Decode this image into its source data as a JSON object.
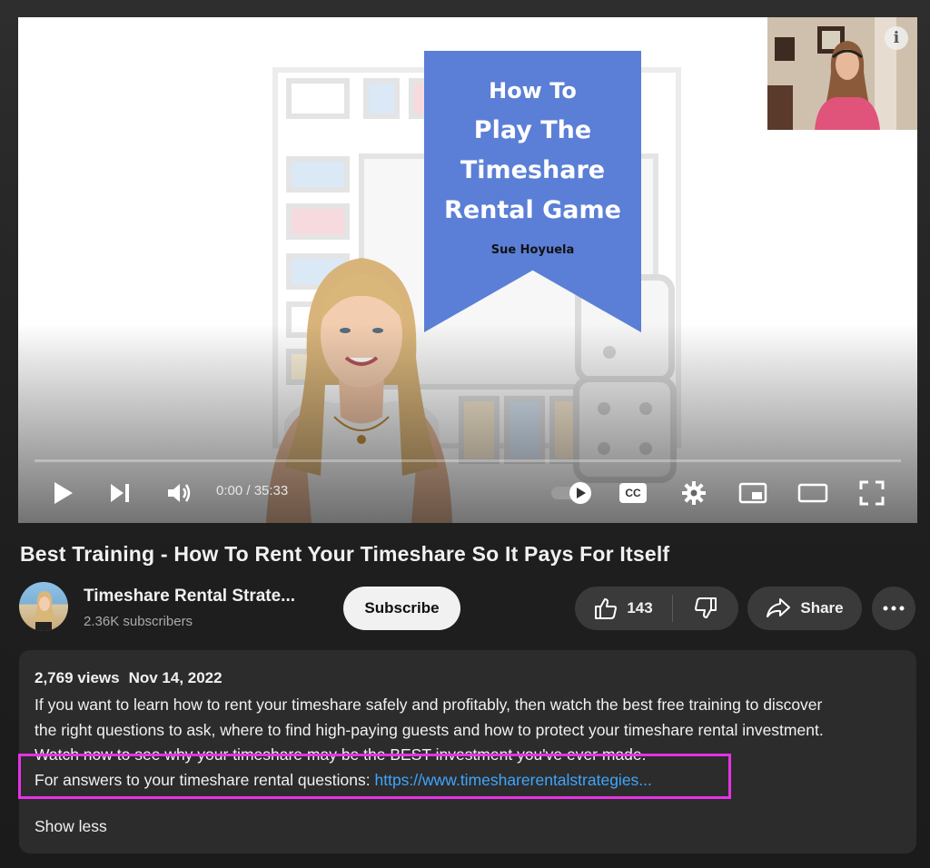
{
  "player": {
    "thumbnail": {
      "title_lines": [
        "How To",
        "Play The",
        "Timeshare",
        "Rental Game"
      ],
      "author": "Sue Hoyuela"
    },
    "time_display": "0:00 / 35:33",
    "progress_fraction": 0.0,
    "icons": [
      "play-icon",
      "next-icon",
      "volume-icon",
      "autoplay-toggle",
      "cc-icon",
      "gear-icon",
      "miniplayer-icon",
      "theater-icon",
      "fullscreen-icon",
      "info-icon"
    ],
    "cc_label": "CC",
    "info_label": "i"
  },
  "video": {
    "title": "Best Training - How To Rent Your Timeshare So It Pays For Itself"
  },
  "channel": {
    "name": "Timeshare Rental Strate...",
    "subscribers": "2.36K subscribers",
    "subscribe_label": "Subscribe"
  },
  "actions": {
    "like_count": "143",
    "share_label": "Share"
  },
  "description": {
    "views": "2,769 views",
    "date": "Nov 14, 2022",
    "lines": [
      "If you want to learn how to rent your timeshare safely and profitably, then watch the best free training to discover",
      "the right questions to ask, where to find high-paying guests and how to protect your timeshare rental investment.",
      "Watch now to see why your timeshare may be the BEST investment you've ever made."
    ],
    "answers_prefix": "For answers to your timeshare rental questions: ",
    "answers_link": "https://www.timesharerentalstrategies...",
    "show_less": "Show less"
  },
  "colors": {
    "ribbon": "#5b7fd6",
    "link": "#3ea6ff",
    "highlight": "#e632e6"
  }
}
